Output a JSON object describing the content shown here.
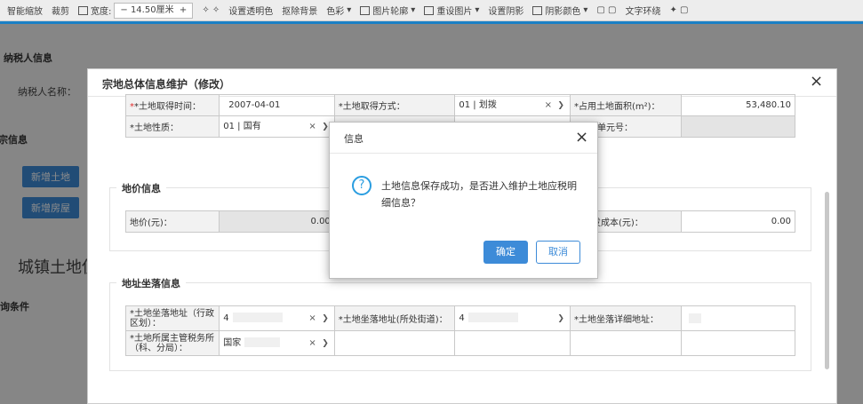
{
  "toolbar": {
    "smart_zoom": "智能缩放",
    "crop": "裁剪",
    "width_label": "宽度:",
    "width_value": "14.50厘米",
    "set_transparent": "设置透明色",
    "remove_bg": "抠除背景",
    "color": "色彩",
    "picture_outline": "图片轮廓",
    "reset_picture": "重设图片",
    "set_shadow": "设置阴影",
    "shadow_color": "阴影颜色",
    "text_wrap": "文字环绕"
  },
  "background": {
    "section_taxpayer": "纳税人信息",
    "taxpayer_name_label": "纳税人名称：",
    "section_info": "宗信息",
    "btn_add_land": "新增土地",
    "btn_add_house": "新增房屋",
    "big_title": "城镇土地使",
    "section_conditions": "询条件"
  },
  "modal": {
    "title": "宗地总体信息维护（修改）",
    "basic": {
      "acq_time_label": "*土地取得时间：",
      "acq_time_value": "2007-04-01",
      "acq_method_label": "*土地取得方式：",
      "acq_method_value": "01 | 划拨",
      "area_label": "*占用土地面积(m²)：",
      "area_value": "53,480.10",
      "nature_label": "*土地性质：",
      "nature_value": "01 | 国有",
      "unit_no_label": "单元号："
    },
    "land_price": {
      "legend": "地价信息",
      "price_label": "地价(元)：",
      "price_value": "0.00",
      "dev_cost_label": "地开发成本(元)：",
      "dev_cost_value": "0.00"
    },
    "address": {
      "legend": "地址坐落信息",
      "admin_label": "*土地坐落地址（行政区划）：",
      "admin_value": "4",
      "street_label": "*土地坐落地址(所处街道)：",
      "street_value": "4",
      "detail_label": "*土地坐落详细地址：",
      "tax_office_label": "*土地所属主管税务所（科、分局）：",
      "tax_office_value": "国家"
    }
  },
  "dialog": {
    "title": "信息",
    "message": "土地信息保存成功，是否进入维护土地应税明细信息？",
    "ok": "确定",
    "cancel": "取消"
  },
  "colors": {
    "primary": "#3d8bd8",
    "required": "#e12d2d",
    "accent_line": "#1b80c5"
  }
}
